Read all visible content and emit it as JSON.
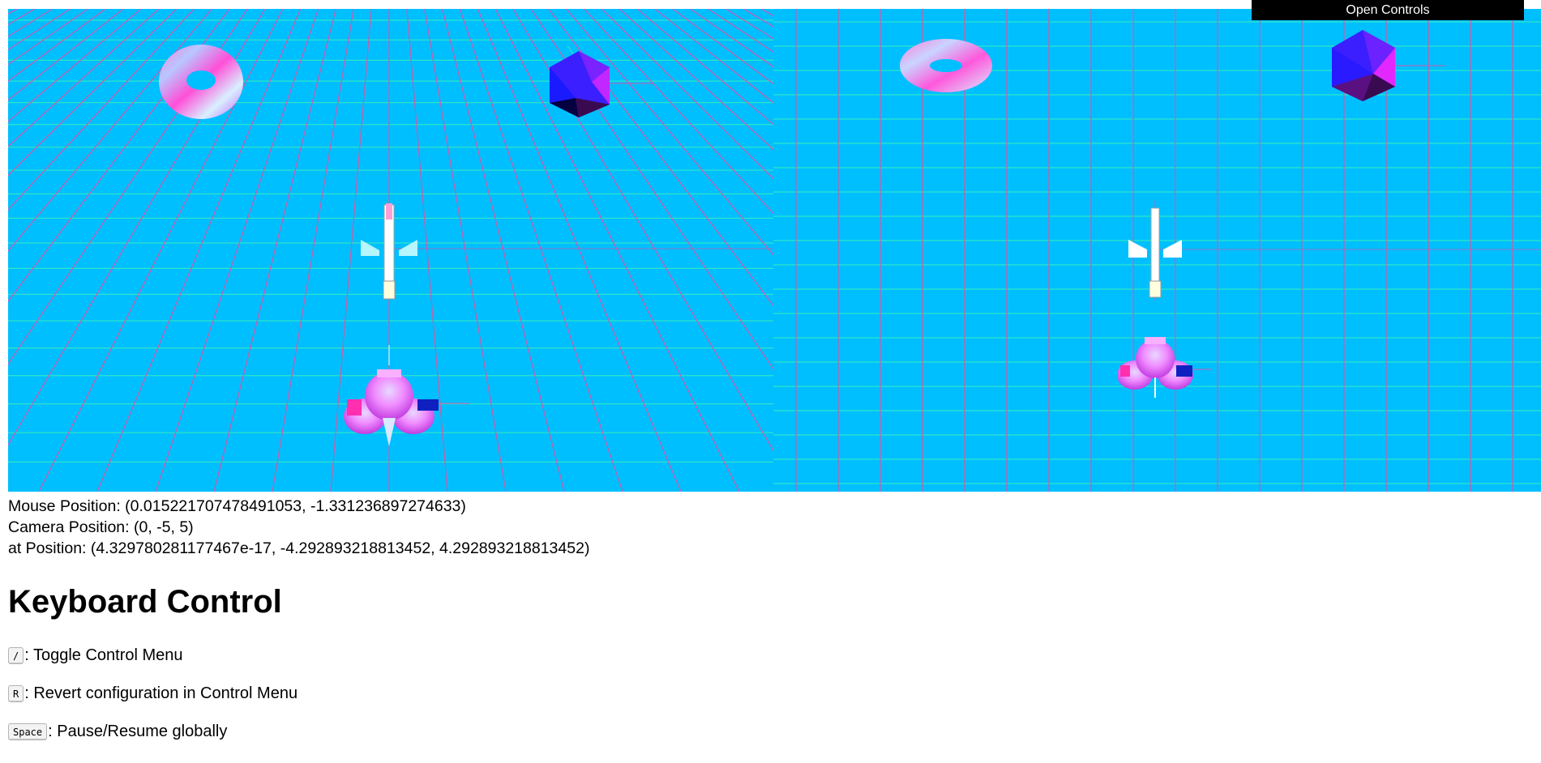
{
  "controls": {
    "open_label": "Open Controls"
  },
  "info": {
    "mouse_label": "Mouse Position: ",
    "mouse_value": "(0.015221707478491053, -1.331236897274633)",
    "camera_label": "Camera Position: ",
    "camera_value": "(0, -5, 5)",
    "at_label": "at Position: ",
    "at_value": "(4.329780281177467e-17, -4.292893218813452, 4.292893218813452)"
  },
  "keyboard": {
    "title": "Keyboard Control",
    "shortcuts": [
      {
        "key": "/",
        "description": ": Toggle Control Menu"
      },
      {
        "key": "R",
        "description": ": Revert configuration in Control Menu"
      },
      {
        "key": "Space",
        "description": ": Pause/Resume globally"
      }
    ]
  },
  "colors": {
    "scene_background": "#00bfff",
    "grid_horizontal": "#2ee6c6",
    "grid_vertical": "#d05aa8",
    "button_background": "#000000"
  },
  "scene": {
    "left_view": "perspective",
    "right_view": "orthographic",
    "objects": [
      "torus",
      "icosahedron",
      "airplane",
      "flower"
    ]
  }
}
